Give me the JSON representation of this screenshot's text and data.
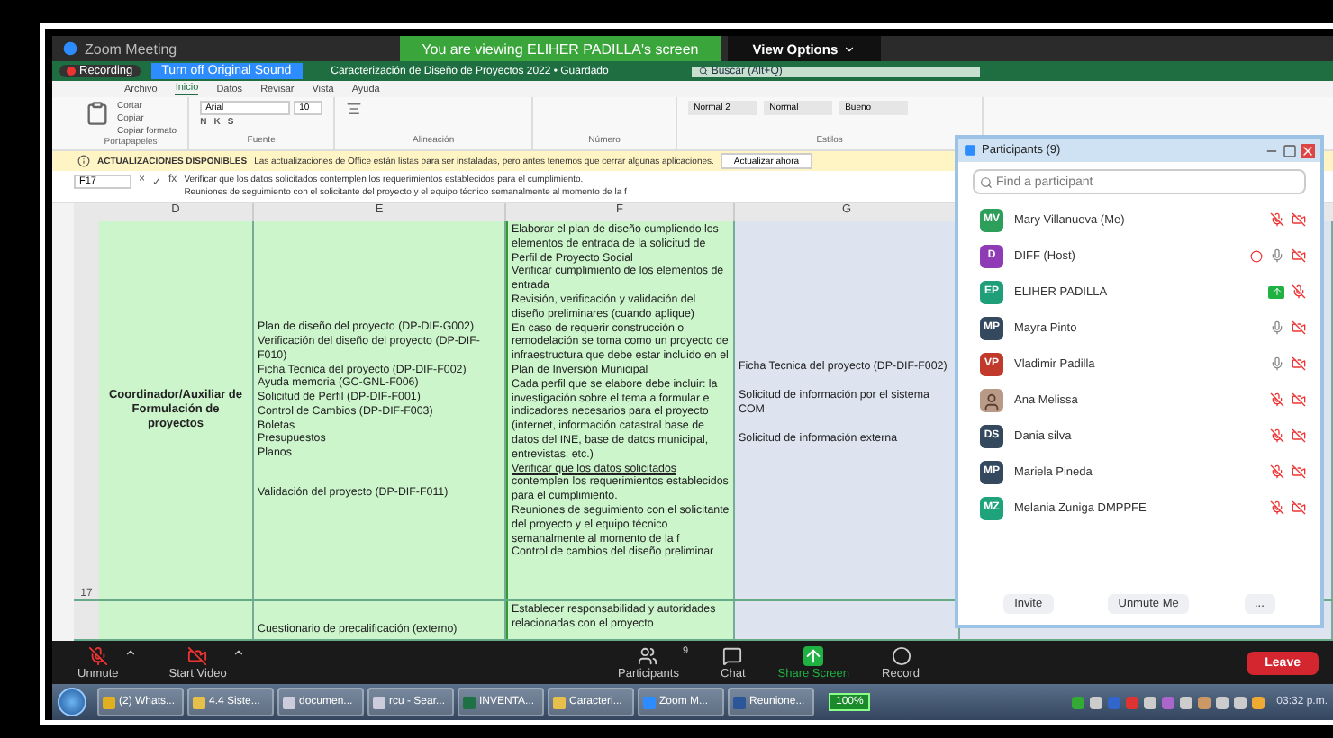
{
  "window": {
    "title": "Zoom Meeting",
    "banner": "You are viewing ELIHER  PADILLA's screen",
    "view_options": "View Options"
  },
  "excel": {
    "recording": "Recording",
    "original_sound": "Turn off Original Sound",
    "doc_title": "Caracterización de Diseño de Proyectos 2022 • Guardado",
    "search": "Buscar (Alt+Q)",
    "tabs": [
      {
        "label": "Archivo",
        "selected": false
      },
      {
        "label": "Inicio",
        "selected": true
      },
      {
        "label": "Datos",
        "selected": false
      },
      {
        "label": "Revisar",
        "selected": false
      },
      {
        "label": "Vista",
        "selected": false
      },
      {
        "label": "Ayuda",
        "selected": false
      }
    ],
    "clipboard": {
      "items": [
        "Cortar",
        "Copiar",
        "Copiar formato"
      ],
      "label": "Portapapeles"
    },
    "font": {
      "name": "Arial",
      "size": "10",
      "styles": [
        "N",
        "K",
        "S"
      ],
      "label": "Fuente"
    },
    "alignment": {
      "label": "Alineación"
    },
    "number": {
      "label": "Número"
    },
    "styles": {
      "cells": [
        "Normal 2",
        "Normal",
        "Bueno"
      ],
      "label": "Estilos"
    },
    "info_bar": {
      "title": "ACTUALIZACIONES DISPONIBLES",
      "message": "Las actualizaciones de Office están listas para ser instaladas, pero antes tenemos que cerrar algunas aplicaciones.",
      "button": "Actualizar ahora"
    },
    "formula_bar": {
      "cell": "F17",
      "buttons": [
        "×",
        "✓",
        "fx"
      ],
      "lines": [
        "Verificar que los datos solicitados contemplen los requerimientos establecidos para el cumplimiento.",
        "Reuniones de seguimiento con el solicitante del proyecto y el equipo técnico semanalmente al momento de la f"
      ]
    },
    "columns": [
      "D",
      "E",
      "F",
      "G"
    ],
    "rows": [
      {
        "header": "17",
        "d": "Coordinador/Auxiliar de Formulación de proyectos",
        "e": [
          "Plan de diseño del proyecto (DP-DIF-G002)",
          "Verificación del diseño del proyecto (DP-DIF-F010)",
          "Ficha Tecnica del proyecto (DP-DIF-F002)",
          "Ayuda memoria (GC-GNL-F006)",
          "Solicitud de Perfil  (DP-DIF-F001)",
          "Control de Cambios (DP-DIF-F003)",
          "Boletas",
          "Presupuestos",
          "Planos",
          "Validación del proyecto  (DP-DIF-F011)"
        ],
        "f": [
          {
            "text": "Elaborar el plan de diseño cumpliendo los elementos de entrada de la solicitud de Perfil de Proyecto Social",
            "underline": false
          },
          {
            "text": "Verificar cumplimiento de los elementos de entrada",
            "underline": false
          },
          {
            "text": "Revisión, verificación y validación del diseño preliminares (cuando aplique)",
            "underline": false
          },
          {
            "text": "En caso de requerir construcción o remodelación se toma como un proyecto de infraestructura que debe estar incluido en el Plan de Inversión Municipal",
            "underline": false
          },
          {
            "text": "Cada perfil que se elabore debe incluir: la investigación sobre el tema a formular e indicadores necesarios para el proyecto (internet, información catastral  base de datos del INE, base de datos municipal, entrevistas, etc.)",
            "underline": false
          },
          {
            "text": "Verificar que los datos solicitados",
            "underline": true
          },
          {
            "text": "contemplen los requerimientos establecidos para el cumplimiento.",
            "underline": false
          },
          {
            "text": "Reuniones de seguimiento con el solicitante del proyecto y el equipo técnico semanalmente al momento de la f",
            "underline": false
          },
          {
            "text": "Control de cambios del diseño preliminar",
            "underline": false
          }
        ],
        "g": [
          "Ficha Tecnica del proyecto (DP-DIF-F002)",
          "Solicitud de información por el sistema COM",
          "Solicitud de información externa"
        ]
      },
      {
        "header": "",
        "d": "",
        "e": [
          "Cuestionario de precalificación (externo)"
        ],
        "f": [
          {
            "text": "Establecer responsabilidad y autoridades relacionadas con el proyecto",
            "underline": false
          }
        ],
        "g": []
      }
    ]
  },
  "participants": {
    "title": "Participants (9)",
    "placeholder": "Find a participant",
    "items": [
      {
        "kind": "initials",
        "initials": "MV",
        "name": "Mary Villanueva (Me)",
        "color": "#2e9e5b",
        "muted": true,
        "recording": false,
        "sharing": false
      },
      {
        "kind": "initials",
        "initials": "D",
        "name": "DIFF (Host)",
        "color": "#8e3bb5",
        "muted": false,
        "recording": true,
        "sharing": false
      },
      {
        "kind": "initials",
        "initials": "EP",
        "name": "ELIHER  PADILLA",
        "color": "#1f9e7a",
        "muted": true,
        "recording": false,
        "sharing": true
      },
      {
        "kind": "initials",
        "initials": "MP",
        "name": "Mayra Pinto",
        "color": "#34495e",
        "muted": false,
        "recording": false,
        "sharing": false
      },
      {
        "kind": "initials",
        "initials": "VP",
        "name": "Vladimir Padilla",
        "color": "#c0392b",
        "muted": false,
        "recording": false,
        "sharing": false
      },
      {
        "kind": "photo",
        "name": "Ana Melissa",
        "muted": true,
        "recording": false,
        "sharing": false
      },
      {
        "kind": "initials",
        "initials": "DS",
        "name": "Dania silva",
        "color": "#34495e",
        "muted": true,
        "recording": false,
        "sharing": false
      },
      {
        "kind": "initials",
        "initials": "MP",
        "name": "Mariela Pineda",
        "color": "#34495e",
        "muted": true,
        "recording": false,
        "sharing": false
      },
      {
        "kind": "initials",
        "initials": "MZ",
        "name": "Melania Zuniga DMPPFE",
        "color": "#1fa37a",
        "muted": true,
        "recording": false,
        "sharing": false
      }
    ],
    "buttons": [
      "Invite",
      "Unmute Me",
      "..."
    ]
  },
  "toolbar": {
    "items": [
      {
        "kind": "mic",
        "label": "Unmute"
      },
      {
        "kind": "video",
        "label": "Start Video"
      },
      {
        "kind": "participants",
        "label": "Participants",
        "count": "9"
      },
      {
        "kind": "chat",
        "label": "Chat"
      },
      {
        "kind": "share",
        "label": "Share Screen"
      },
      {
        "kind": "record",
        "label": "Record"
      }
    ],
    "leave": "Leave"
  },
  "taskbar": {
    "items": [
      {
        "kind": "browser",
        "label": "(2) Whats..."
      },
      {
        "kind": "folder",
        "label": "4.4 Siste..."
      },
      {
        "kind": "search",
        "label": "documen..."
      },
      {
        "kind": "search",
        "label": "rcu - Sear..."
      },
      {
        "kind": "excel",
        "label": "INVENTA..."
      },
      {
        "kind": "folder",
        "label": "Caracteri..."
      },
      {
        "kind": "zoom",
        "label": "Zoom M..."
      },
      {
        "kind": "word",
        "label": "Reunione..."
      }
    ],
    "battery": "100%",
    "time": "03:32 p.m."
  }
}
